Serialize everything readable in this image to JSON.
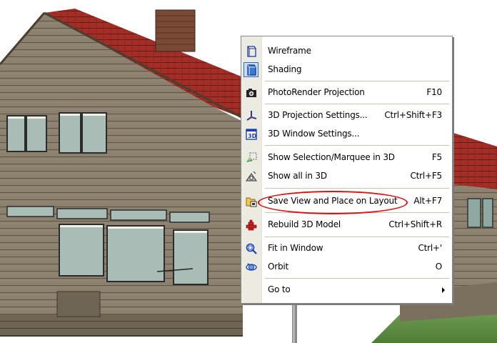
{
  "menu": {
    "items": [
      {
        "label": "Wireframe",
        "shortcut": "",
        "icon": "wireframe-icon"
      },
      {
        "label": "Shading",
        "shortcut": "",
        "icon": "shading-icon"
      },
      {
        "label": "PhotoRender Projection",
        "shortcut": "F10",
        "icon": "camera-icon"
      },
      {
        "label": "3D Projection Settings...",
        "shortcut": "Ctrl+Shift+F3",
        "icon": "projection-settings-icon"
      },
      {
        "label": "3D Window Settings...",
        "shortcut": "",
        "icon": "window-settings-icon"
      },
      {
        "label": "Show Selection/Marquee in 3D",
        "shortcut": "F5",
        "icon": "show-selection-icon"
      },
      {
        "label": "Show all in 3D",
        "shortcut": "Ctrl+F5",
        "icon": "show-all-icon"
      },
      {
        "label": "Save View and Place on Layout",
        "shortcut": "Alt+F7",
        "icon": "save-view-icon"
      },
      {
        "label": "Rebuild 3D Model",
        "shortcut": "Ctrl+Shift+R",
        "icon": "rebuild-icon"
      },
      {
        "label": "Fit in Window",
        "shortcut": "Ctrl+'",
        "icon": "fit-window-icon"
      },
      {
        "label": "Orbit",
        "shortcut": "O",
        "icon": "orbit-icon"
      },
      {
        "label": "Go to",
        "shortcut": "",
        "icon": ""
      }
    ]
  },
  "colors": {
    "roof": "#9a2a22",
    "siding": "#8a7d6b",
    "highlight": "#e01010",
    "selected_bg": "#c9ddf6"
  }
}
